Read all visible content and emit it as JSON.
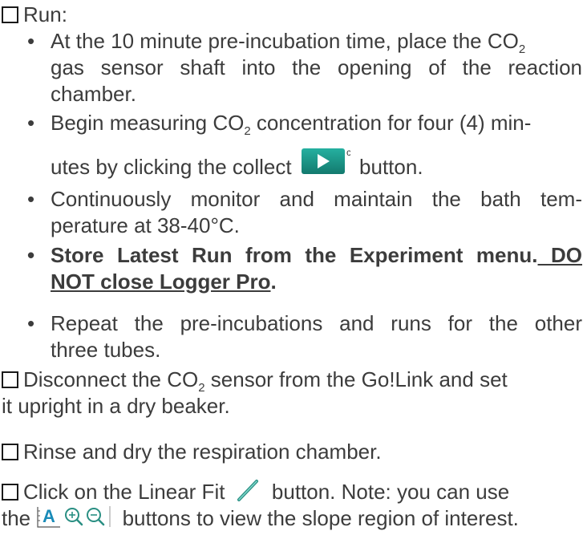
{
  "run": {
    "heading": "Run:",
    "b1": {
      "l1a": "At the 10 minute pre-incubation time, place the CO",
      "l1sub": "2",
      "l2": "gas sensor shaft into the opening of the reaction",
      "l3": "chamber."
    },
    "b2": {
      "l1a": "Begin measuring CO",
      "l1sub": "2",
      "l1b": " concentration for four (4) min-",
      "l2a": "utes by clicking the collect ",
      "l2b": " button."
    },
    "b3": {
      "l1": "Continuously monitor and maintain the bath tem-",
      "l2": "perature at 38-40°C."
    },
    "b4": {
      "l1a": "Store Latest Run from the Experiment menu.",
      "l1b": " DO",
      "l2a": "NOT close Logger Pro",
      "l2b": "."
    },
    "b5": {
      "l1": "Repeat the pre-incubations and runs for the other",
      "l2": "three tubes."
    }
  },
  "disconnect": {
    "l1a": "Disconnect the CO",
    "l1sub": "2",
    "l1b": " sensor from the Go!Link and set",
    "l2": "it upright in a dry beaker."
  },
  "rinse": {
    "l1": "Rinse and dry the respiration chamber."
  },
  "linear": {
    "l1a": "Click on the Linear Fit ",
    "l1b": " button. Note: you can use",
    "l2a": "the ",
    "l2b": " buttons to view the slope region of interest."
  },
  "icons": {
    "bullet": "•",
    "checkbox": "checkbox-icon",
    "collect": "play-icon",
    "linear_fit": "linear-fit-icon",
    "autoscale": "autoscale-icon",
    "zoom_in": "zoom-in-icon",
    "zoom_out": "zoom-out-icon",
    "accent": "#1a9a8c"
  }
}
